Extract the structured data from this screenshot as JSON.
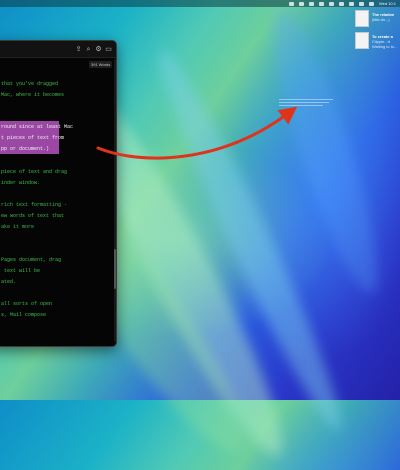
{
  "menubar": {
    "clock": "Wed 10:1",
    "icons": [
      "app-icon",
      "app-icon",
      "app-icon",
      "app-icon",
      "app-icon",
      "app-icon",
      "wifi-icon",
      "search-icon",
      "control-center-icon"
    ]
  },
  "notifications": [
    {
      "title": "The relative",
      "subtitle": "(title-lin...)",
      "icon": "document-thumbnail-icon"
    },
    {
      "title": "To create a",
      "subtitle": "Clippin...rt",
      "extra": "Waiting to lo...",
      "icon": "document-thumbnail-icon"
    }
  ],
  "editor": {
    "toolbar_icons": [
      "share-icon",
      "search-icon",
      "settings-icon",
      "sidebar-icon"
    ],
    "word_count": "391 Words",
    "lines": [
      "that you've dragged",
      "Mac, where it becomes",
      "",
      "round since at least Mac",
      "t pieces of text from",
      "pp or document.)",
      "",
      "piece of text and drag",
      "inder window.",
      "",
      "rich text formatting -",
      "ew words of text that",
      "ake it more",
      "",
      "",
      "Pages document, drag",
      " text will be",
      "ated.",
      "",
      "all sorts of open",
      "s, Mail compose"
    ]
  },
  "colors": {
    "text_green": "#3fbf4e",
    "selection_purple": "#9b48a4",
    "arrow_red": "#e0331c"
  }
}
